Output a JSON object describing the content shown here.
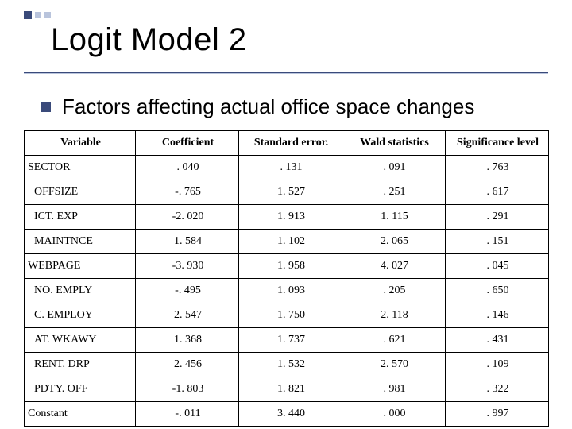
{
  "chart_data": {
    "type": "table",
    "title": "Logit Model 2",
    "subtitle": "Factors affecting actual office space changes",
    "columns": [
      "Variable",
      "Coefficient",
      "Standard error.",
      "Wald statistics",
      "Significance level"
    ],
    "rows": [
      {
        "variable": "SECTOR",
        "flush": true,
        "coefficient": ". 040",
        "stderr": ". 131",
        "wald": ". 091",
        "sig": ". 763"
      },
      {
        "variable": "OFFSIZE",
        "flush": false,
        "coefficient": "-. 765",
        "stderr": "1. 527",
        "wald": ". 251",
        "sig": ". 617"
      },
      {
        "variable": "ICT. EXP",
        "flush": false,
        "coefficient": "-2. 020",
        "stderr": "1. 913",
        "wald": "1. 115",
        "sig": ". 291"
      },
      {
        "variable": "MAINTNCE",
        "flush": false,
        "coefficient": "1. 584",
        "stderr": "1. 102",
        "wald": "2. 065",
        "sig": ". 151"
      },
      {
        "variable": "WEBPAGE",
        "flush": true,
        "coefficient": "-3. 930",
        "stderr": "1. 958",
        "wald": "4. 027",
        "sig": ". 045"
      },
      {
        "variable": "NO. EMPLY",
        "flush": false,
        "coefficient": "-. 495",
        "stderr": "1. 093",
        "wald": ". 205",
        "sig": ". 650"
      },
      {
        "variable": "C. EMPLOY",
        "flush": false,
        "coefficient": "2. 547",
        "stderr": "1. 750",
        "wald": "2. 118",
        "sig": ". 146"
      },
      {
        "variable": "AT. WKAWY",
        "flush": false,
        "coefficient": "1. 368",
        "stderr": "1. 737",
        "wald": ". 621",
        "sig": ". 431"
      },
      {
        "variable": "RENT. DRP",
        "flush": false,
        "coefficient": "2. 456",
        "stderr": "1. 532",
        "wald": "2. 570",
        "sig": ". 109"
      },
      {
        "variable": "PDTY. OFF",
        "flush": false,
        "coefficient": "-1. 803",
        "stderr": "1. 821",
        "wald": ". 981",
        "sig": ". 322"
      },
      {
        "variable": "Constant",
        "flush": true,
        "coefficient": "-. 011",
        "stderr": "3. 440",
        "wald": ". 000",
        "sig": ". 997"
      }
    ]
  }
}
